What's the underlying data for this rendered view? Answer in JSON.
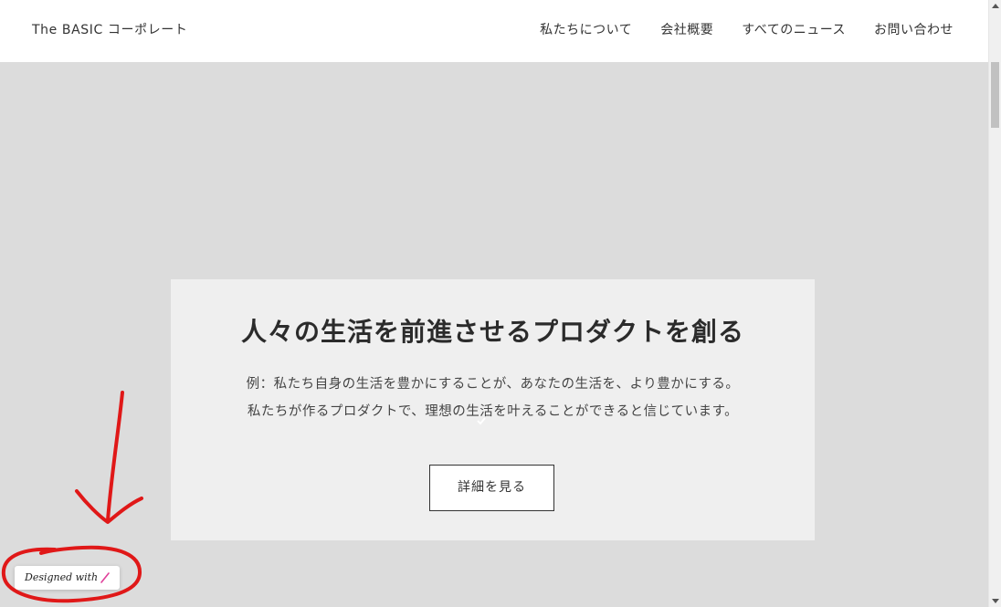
{
  "header": {
    "logo": "The BASIC コーポレート",
    "nav": [
      {
        "label": "私たちについて"
      },
      {
        "label": "会社概要"
      },
      {
        "label": "すべてのニュース"
      },
      {
        "label": "お問い合わせ"
      }
    ]
  },
  "hero": {
    "title": "人々の生活を前進させるプロダクトを創る",
    "lines": [
      "例：私たち自身の生活を豊かにすることが、あなたの生活を、より豊かにする。",
      "私たちが作るプロダクトで、理想の生活を叶えることができると信じています。"
    ],
    "button_label": "詳細を見る"
  },
  "badge": {
    "label": "Designed with",
    "icon": "pen-icon"
  },
  "colors": {
    "page_background": "#dcdcdc",
    "card_background": "#efefef",
    "header_background": "#ffffff",
    "annotation_red": "#e01818",
    "pen_pink": "#e0409a"
  }
}
